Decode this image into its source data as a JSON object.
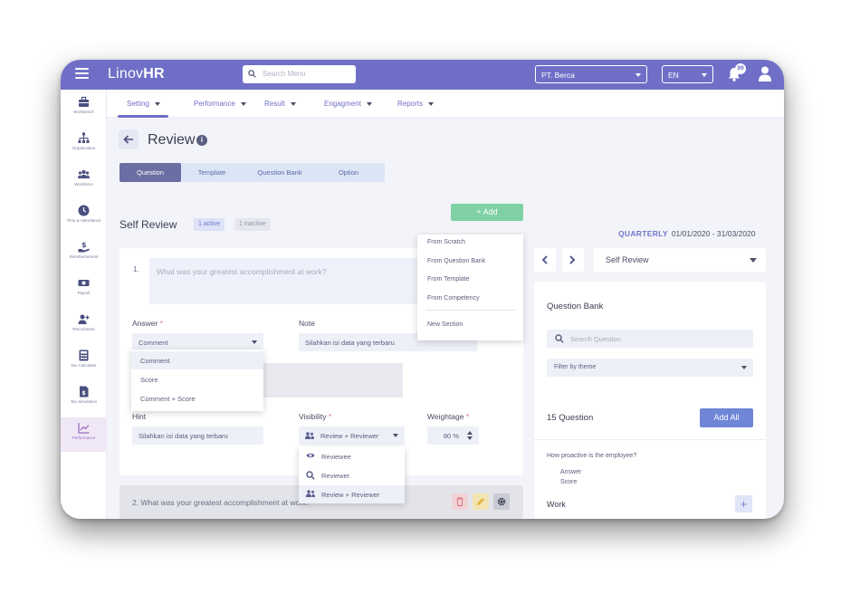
{
  "topbar": {
    "logo_light": "Linov",
    "logo_bold": "HR",
    "search_placeholder": "Search Menu",
    "company": "PT. Berca",
    "language": "EN",
    "notification_count": "99"
  },
  "sidebar": {
    "items": [
      {
        "label": "Workbench",
        "icon": "briefcase-icon"
      },
      {
        "label": "Organization",
        "icon": "org-chart-icon"
      },
      {
        "label": "Workforce",
        "icon": "people-icon"
      },
      {
        "label": "Time & Attendance",
        "icon": "clock-icon"
      },
      {
        "label": "Reimbursement",
        "icon": "money-hand-icon"
      },
      {
        "label": "Payroll",
        "icon": "cash-icon"
      },
      {
        "label": "Recruitment",
        "icon": "user-plus-icon"
      },
      {
        "label": "Tax Calculator",
        "icon": "calculator-icon"
      },
      {
        "label": "Tax Simulation",
        "icon": "tax-doc-icon"
      },
      {
        "label": "Performance",
        "icon": "chart-icon"
      }
    ]
  },
  "subnav": {
    "items": [
      "Setting",
      "Performance",
      "Result",
      "Engagment",
      "Reports"
    ]
  },
  "page": {
    "title": "Review",
    "tabs": [
      "Question",
      "Template",
      "Question Bank",
      "Option"
    ]
  },
  "self_review": {
    "title": "Self Review",
    "active_pill": "1 active",
    "inactive_pill": "1 inactive",
    "add_button": "+ Add",
    "add_menu": [
      "From Scratch",
      "From Question Bank",
      "From Template",
      "From Competency",
      "New Section"
    ]
  },
  "question1": {
    "number": "1.",
    "placeholder": "What was your greatest accomplishment at work?",
    "answer_label": "Answer",
    "answer_value": "Comment",
    "answer_options": [
      "Comment",
      "Score",
      "Comment + Score"
    ],
    "note_label": "Note",
    "note_value": "Silahkan isi data yang terbaru",
    "hint_label": "Hint",
    "hint_value": "Silahkan isi data yang terbaru",
    "visibility_label": "Visibility",
    "visibility_value": "Review + Reviewer",
    "visibility_options": [
      "Reviewee",
      "Reviewer",
      "Review + Reviewer"
    ],
    "weightage_label": "Weightage",
    "weightage_value": "80",
    "weightage_unit": "%",
    "required_mark": "*"
  },
  "question2": {
    "text": "2. What was your greatest accomplishment at work?"
  },
  "right_panel": {
    "period_label": "QUARTERLY",
    "period_range": "01/01/2020 - 31/03/2020",
    "review_select": "Self Review",
    "bank_title": "Question Bank",
    "search_placeholder": "Search Question",
    "filter": "Filter by theme",
    "count": "15 Question",
    "add_all": "Add All",
    "sample_question": "How proactive is the employee?",
    "sample_answer_1": "Answer",
    "sample_answer_2": "Score",
    "section": "Work",
    "plus": "+"
  },
  "colors": {
    "brand": "#6f6fc8",
    "add_green": "#7fd1a4",
    "add_all_blue": "#6f86d6"
  }
}
